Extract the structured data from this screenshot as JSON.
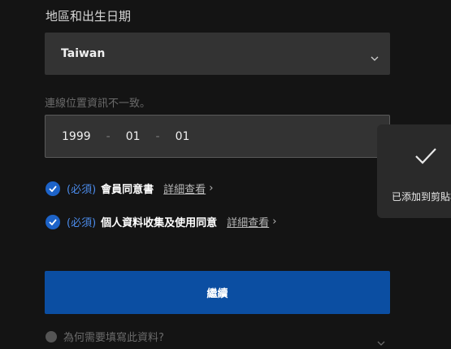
{
  "region": {
    "label": "地區和出生日期",
    "selected": "Taiwan"
  },
  "warning": "連線位置資訊不一致。",
  "birth_date": {
    "year": "1999",
    "month": "01",
    "day": "01",
    "separator": "-"
  },
  "terms": [
    {
      "required": "(必須)",
      "name": "會員同意書",
      "detail": "詳細查看",
      "arrow": "›"
    },
    {
      "required": "(必須)",
      "name": "個人資料收集及使用同意",
      "detail": "詳細查看",
      "arrow": "›"
    }
  ],
  "continue_label": "繼續",
  "help_text": "為何需要填寫此資料?",
  "toast": {
    "message": "已添加到剪貼板"
  },
  "colors": {
    "accent": "#1d63c8",
    "button": "#0b4ea2",
    "field": "#333333"
  }
}
